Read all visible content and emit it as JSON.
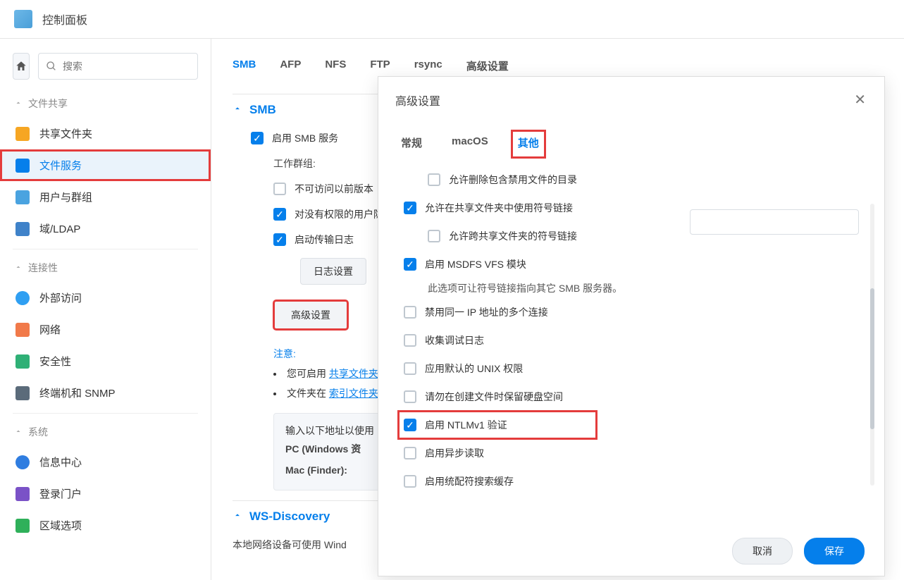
{
  "header": {
    "title": "控制面板"
  },
  "search": {
    "placeholder": "搜索"
  },
  "groups": {
    "file_sharing": "文件共享",
    "connectivity": "连接性",
    "system": "系统"
  },
  "sidebar": {
    "items": [
      {
        "label": "共享文件夹",
        "icon": "folder-icon",
        "color": "#f6a623"
      },
      {
        "label": "文件服务",
        "icon": "file-service-icon",
        "color": "#057FEB"
      },
      {
        "label": "用户与群组",
        "icon": "users-icon",
        "color": "#4aa3e0"
      },
      {
        "label": "域/LDAP",
        "icon": "ldap-icon",
        "color": "#3f82c9"
      },
      {
        "label": "外部访问",
        "icon": "globe-icon",
        "color": "#2f9ff2"
      },
      {
        "label": "网络",
        "icon": "network-icon",
        "color": "#f17a4a"
      },
      {
        "label": "安全性",
        "icon": "shield-icon",
        "color": "#2fb076"
      },
      {
        "label": "终端机和 SNMP",
        "icon": "terminal-icon",
        "color": "#5b6b7a"
      },
      {
        "label": "信息中心",
        "icon": "info-icon",
        "color": "#2f7de0"
      },
      {
        "label": "登录门户",
        "icon": "portal-icon",
        "color": "#7a52c7"
      },
      {
        "label": "区域选项",
        "icon": "region-icon",
        "color": "#2fb05a"
      }
    ]
  },
  "tabs": [
    "SMB",
    "AFP",
    "NFS",
    "FTP",
    "rsync",
    "高级设置"
  ],
  "smb": {
    "section": "SMB",
    "enable": "启用 SMB 服务",
    "workgroup_label": "工作群组:",
    "prev_version": "不可访问以前版本",
    "no_perm": "对没有权限的用户隐藏",
    "transfer_log": "启动传输日志",
    "log_btn": "日志设置",
    "adv_btn": "高级设置",
    "note": "注意:",
    "note1_prefix": "您可启用 ",
    "note1_link": "共享文件夹",
    "note2_prefix": "文件夹在 ",
    "note2_link": "索引文件夹",
    "address_hint": "输入以下地址以使用",
    "pc_line": "PC (Windows 资",
    "mac_line": "Mac (Finder):"
  },
  "ws": {
    "section": "WS-Discovery",
    "desc": "本地网络设备可使用 Wind"
  },
  "modal": {
    "title": "高级设置",
    "tabs": [
      "常规",
      "macOS",
      "其他"
    ],
    "rows": {
      "allow_delete": "允许删除包含禁用文件的目录",
      "symlinks": "允许在共享文件夹中使用符号链接",
      "cross_symlinks": "允许跨共享文件夹的符号链接",
      "msdfs": "启用 MSDFS VFS 模块",
      "msdfs_desc": "此选项可让符号链接指向其它 SMB 服务器。",
      "disable_multi_ip": "禁用同一 IP 地址的多个连接",
      "debug_log": "收集调试日志",
      "unix_perm": "应用默认的 UNIX 权限",
      "reserve_space": "请勿在创建文件时保留硬盘空间",
      "ntlmv1": "启用 NTLMv1 验证",
      "async_read": "启用异步读取",
      "wildcard": "启用统配符搜索缓存"
    },
    "buttons": {
      "cancel": "取消",
      "save": "保存"
    }
  }
}
